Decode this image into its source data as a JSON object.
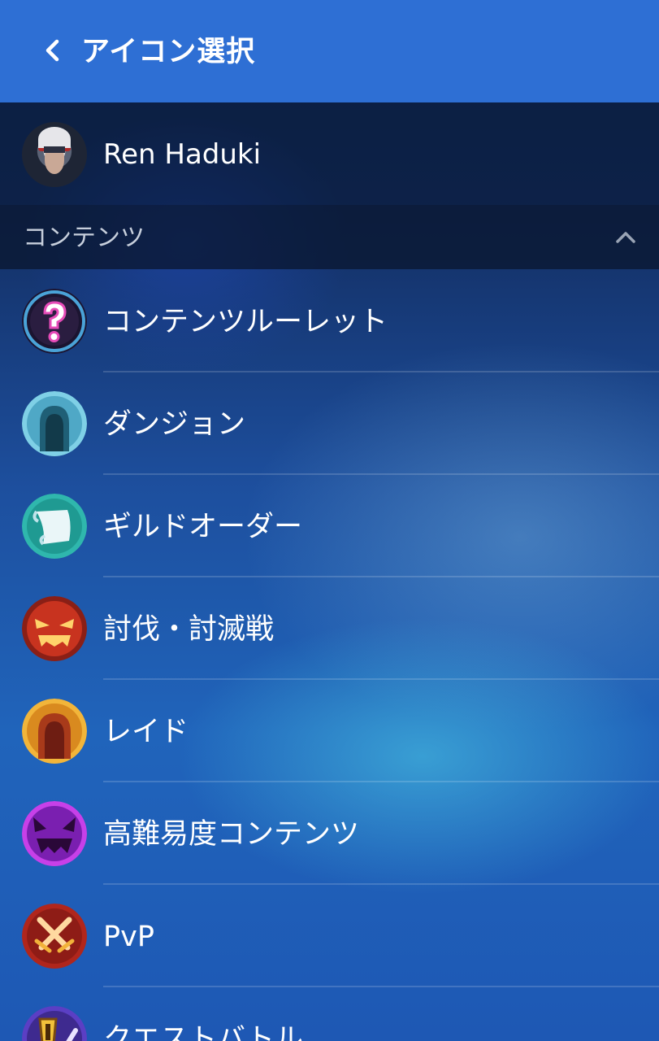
{
  "header": {
    "title": "アイコン選択"
  },
  "profile": {
    "name": "Ren Haduki"
  },
  "section": {
    "label": "コンテンツ"
  },
  "items": [
    {
      "label": "コンテンツルーレット",
      "icon": "question-mark-icon"
    },
    {
      "label": "ダンジョン",
      "icon": "dungeon-cave-icon"
    },
    {
      "label": "ギルドオーダー",
      "icon": "scroll-icon"
    },
    {
      "label": "討伐・討滅戦",
      "icon": "angry-face-icon"
    },
    {
      "label": "レイド",
      "icon": "raid-cave-icon"
    },
    {
      "label": "高難易度コンテンツ",
      "icon": "demon-face-icon"
    },
    {
      "label": "PvP",
      "icon": "crossed-swords-icon"
    },
    {
      "label": "クエストバトル",
      "icon": "quest-alert-icon"
    }
  ],
  "colors": {
    "header": "#2e6fd4",
    "section_bg": "#0a162d",
    "text": "#ffffff"
  }
}
